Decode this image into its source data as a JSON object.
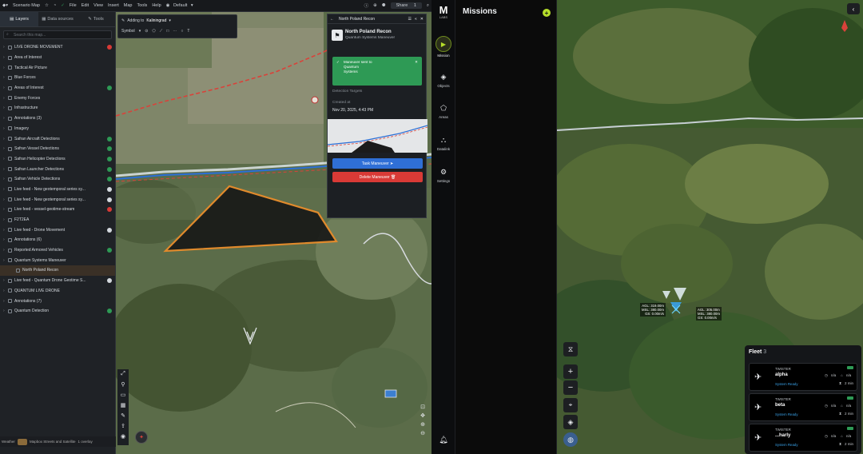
{
  "topbar": {
    "doc_title": "Scenario Map",
    "menus": [
      "File",
      "Edit",
      "View",
      "Insert",
      "Map",
      "Tools",
      "Help"
    ],
    "style_label": "Default",
    "share_label": "Share",
    "share_count": "1"
  },
  "left_panel": {
    "tabs": [
      "Layers",
      "Data sources",
      "Tools"
    ],
    "search_placeholder": "Search this map...",
    "layers": [
      {
        "label": "LIVE DRONE MOVEMENT",
        "status": "#d93a36"
      },
      {
        "label": "Area of Interest",
        "status": ""
      },
      {
        "label": "Tactical Air Picture",
        "status": ""
      },
      {
        "label": "Blue Forces",
        "status": ""
      },
      {
        "label": "Areas of Interest",
        "status": "#2e9a55"
      },
      {
        "label": "Enemy Forces",
        "status": ""
      },
      {
        "label": "Infrastructure",
        "status": ""
      },
      {
        "label": "Annotations (3)",
        "status": ""
      },
      {
        "label": "Imagery",
        "status": ""
      },
      {
        "label": "Safran Aircraft Detections",
        "status": "#2e9a55"
      },
      {
        "label": "Safran Vessel Detections",
        "status": "#2e9a55"
      },
      {
        "label": "Safran Helicopter Detections",
        "status": "#2e9a55"
      },
      {
        "label": "Safran Launcher Detections",
        "status": "#2e9a55"
      },
      {
        "label": "Safran Vehicle Detections",
        "status": "#2e9a55"
      },
      {
        "label": "Live feed - New geotemporal series sy...",
        "status": "#d4d9de"
      },
      {
        "label": "Live feed - New geotemporal series sy...",
        "status": "#d4d9de"
      },
      {
        "label": "Live feed - vessel-geotime-stream",
        "status": "#d93a36"
      },
      {
        "label": "F2T2EA",
        "status": ""
      },
      {
        "label": "Live feed - Drone Movement",
        "status": "#d4d9de"
      },
      {
        "label": "Annotations (6)",
        "status": ""
      },
      {
        "label": "Reported Armored Vehicles",
        "status": "#2e9a55"
      },
      {
        "label": "Quantum Systems Maneuver",
        "status": ""
      },
      {
        "label": "North Poland Recon",
        "status": "",
        "selected": true
      },
      {
        "label": "Live feed - Quantum Drone Geotime S...",
        "status": "#d4d9de"
      },
      {
        "label": "QUANTUM LIVE DRONE",
        "status": ""
      },
      {
        "label": "Annotations (7)",
        "status": ""
      },
      {
        "label": "Quantum Detection",
        "status": "#2e9a55"
      }
    ],
    "basemap_label": "Mapbox Streets and Satellite",
    "overlay_label": "1 overlay",
    "weather_label": "Weather"
  },
  "map1_toolbar": {
    "adding_to": "Adding to",
    "layer_name": "Kaliningrad",
    "symbol_label": "Symbol"
  },
  "popup": {
    "header": "North Poland Recon",
    "title": "North Poland Recon",
    "subtitle": "Quantum Systems Maneuver",
    "toast_line1": "Maneuver sent to",
    "toast_line2": "Quantum",
    "toast_line3": "Systems",
    "section_label": "Detection Targets",
    "created_label": "Created at",
    "created_value": "Nov 20, 2025, 4:43 PM",
    "task_button": "Task Maneuver",
    "delete_button": "Delete Maneuver"
  },
  "nav": {
    "logo_sub": "LABS",
    "items": [
      "Mission",
      "Objects",
      "Areas",
      "Datalink",
      "Settings"
    ]
  },
  "missions": {
    "title": "Missions"
  },
  "map2": {
    "drone1_agl": "AGL: 319.00m",
    "drone1_msl": "MSL: 380.00m",
    "drone1_gs": "GS: 0.00m/s",
    "drone2_agl": "AGL: 305.00m",
    "drone2_msl": "MSL: 380.00m",
    "drone2_gs": "GS: 0.00m/s"
  },
  "fleet": {
    "title": "Fleet",
    "count": "3",
    "drones": [
      {
        "model": "TWISTER",
        "name": "alpha",
        "status": "System Ready",
        "a": "n/a",
        "b": "n/a",
        "eta": "2 min"
      },
      {
        "model": "TWISTER",
        "name": "beta",
        "status": "System Ready",
        "a": "n/a",
        "b": "n/a",
        "eta": "2 min"
      },
      {
        "model": "TWISTER",
        "name": "...harly",
        "status": "System Ready",
        "a": "n/a",
        "b": "n/a",
        "eta": "2 min"
      }
    ]
  },
  "colors": {
    "accent_green": "#2e9a55",
    "danger": "#d93a36",
    "primary": "#2f6fd6",
    "highlight": "#39a0e6"
  }
}
